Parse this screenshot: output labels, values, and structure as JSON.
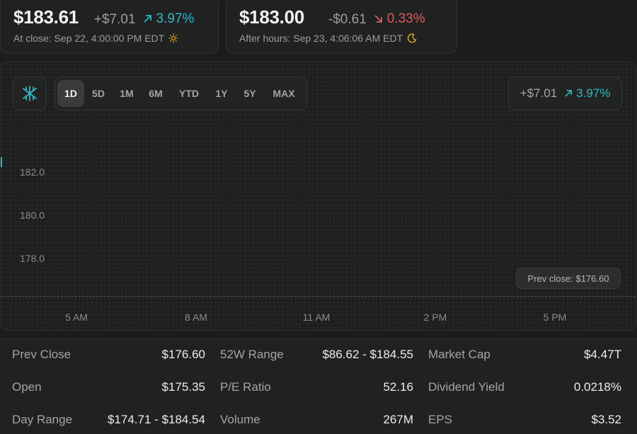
{
  "close_quote": {
    "price": "$183.61",
    "change": "+$7.01",
    "percent": "3.97%",
    "label": "At close: Sep 22, 4:00:00 PM EDT",
    "icon": "sun-icon"
  },
  "after_quote": {
    "price": "$183.00",
    "change": "-$0.61",
    "percent": "0.33%",
    "label": "After hours: Sep 23, 4:06:06 AM EDT",
    "icon": "moon-icon"
  },
  "chart": {
    "ranges": [
      "1D",
      "5D",
      "1M",
      "6M",
      "YTD",
      "1Y",
      "5Y",
      "MAX"
    ],
    "active_range": "1D",
    "change_amount": "+$7.01",
    "change_percent": "3.97%",
    "y_ticks": [
      "182.0",
      "180.0",
      "178.0"
    ],
    "x_ticks": [
      "5 AM",
      "8 AM",
      "11 AM",
      "2 PM",
      "5 PM"
    ],
    "prev_close_label": "Prev close: $176.60"
  },
  "stats": [
    [
      {
        "label": "Prev Close",
        "value": "$176.60"
      },
      {
        "label": "52W Range",
        "value": "$86.62 - $184.55"
      },
      {
        "label": "Market Cap",
        "value": "$4.47T"
      }
    ],
    [
      {
        "label": "Open",
        "value": "$175.35"
      },
      {
        "label": "P/E Ratio",
        "value": "52.16"
      },
      {
        "label": "Dividend Yield",
        "value": "0.0218%"
      }
    ],
    [
      {
        "label": "Day Range",
        "value": "$174.71 - $184.54"
      },
      {
        "label": "Volume",
        "value": "267M"
      },
      {
        "label": "EPS",
        "value": "$3.52"
      }
    ]
  ],
  "colors": {
    "up": "#2fb8c6",
    "down": "#e05a55",
    "sun": "#e0a020",
    "moon": "#e0b020"
  }
}
